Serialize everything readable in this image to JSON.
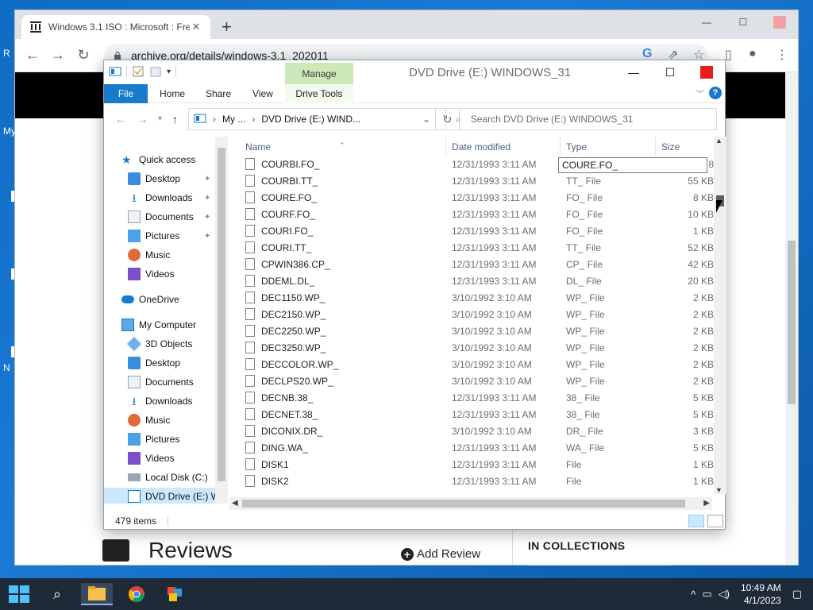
{
  "desktop": {
    "labels": [
      "R",
      "My",
      "N"
    ]
  },
  "browser": {
    "tab_title": "Windows 3.1 ISO : Microsoft : Fre",
    "url": "archive.org/details/windows-3.1_202011",
    "page": {
      "reviews_title": "Reviews",
      "add_review": "Add Review",
      "in_collections": "IN COLLECTIONS"
    }
  },
  "explorer": {
    "window_title": "DVD Drive (E:) WINDOWS_31",
    "contextual_tab_group": "Manage",
    "ribbon_tabs": [
      "File",
      "Home",
      "Share",
      "View",
      "Drive Tools"
    ],
    "breadcrumb": [
      "My ...",
      "DVD Drive (E:) WIND..."
    ],
    "search_placeholder": "Search DVD Drive (E:) WINDOWS_31",
    "nav": {
      "quick_access": "Quick access",
      "quick_items": [
        "Desktop",
        "Downloads",
        "Documents",
        "Pictures",
        "Music",
        "Videos"
      ],
      "onedrive": "OneDrive",
      "my_computer": "My Computer",
      "computer_items": [
        "3D Objects",
        "Desktop",
        "Documents",
        "Downloads",
        "Music",
        "Pictures",
        "Videos",
        "Local Disk (C:)",
        "DVD Drive (E:) W"
      ]
    },
    "columns": [
      "Name",
      "Date modified",
      "Type",
      "Size"
    ],
    "tooltip": "COURE.FO_",
    "files": [
      {
        "name": "COURBI.FO_",
        "date": "12/31/1993 3:11 AM",
        "type": "",
        "size": "8"
      },
      {
        "name": "COURBI.TT_",
        "date": "12/31/1993 3:11 AM",
        "type": "TT_ File",
        "size": "55 KB"
      },
      {
        "name": "COURE.FO_",
        "date": "12/31/1993 3:11 AM",
        "type": "FO_ File",
        "size": "8 KB"
      },
      {
        "name": "COURF.FO_",
        "date": "12/31/1993 3:11 AM",
        "type": "FO_ File",
        "size": "10 KB"
      },
      {
        "name": "COURI.FO_",
        "date": "12/31/1993 3:11 AM",
        "type": "FO_ File",
        "size": "1 KB"
      },
      {
        "name": "COURI.TT_",
        "date": "12/31/1993 3:11 AM",
        "type": "TT_ File",
        "size": "52 KB"
      },
      {
        "name": "CPWIN386.CP_",
        "date": "12/31/1993 3:11 AM",
        "type": "CP_ File",
        "size": "42 KB"
      },
      {
        "name": "DDEML.DL_",
        "date": "12/31/1993 3:11 AM",
        "type": "DL_ File",
        "size": "20 KB"
      },
      {
        "name": "DEC1150.WP_",
        "date": "3/10/1992 3:10 AM",
        "type": "WP_ File",
        "size": "2 KB"
      },
      {
        "name": "DEC2150.WP_",
        "date": "3/10/1992 3:10 AM",
        "type": "WP_ File",
        "size": "2 KB"
      },
      {
        "name": "DEC2250.WP_",
        "date": "3/10/1992 3:10 AM",
        "type": "WP_ File",
        "size": "2 KB"
      },
      {
        "name": "DEC3250.WP_",
        "date": "3/10/1992 3:10 AM",
        "type": "WP_ File",
        "size": "2 KB"
      },
      {
        "name": "DECCOLOR.WP_",
        "date": "3/10/1992 3:10 AM",
        "type": "WP_ File",
        "size": "2 KB"
      },
      {
        "name": "DECLPS20.WP_",
        "date": "3/10/1992 3:10 AM",
        "type": "WP_ File",
        "size": "2 KB"
      },
      {
        "name": "DECNB.38_",
        "date": "12/31/1993 3:11 AM",
        "type": "38_ File",
        "size": "5 KB"
      },
      {
        "name": "DECNET.38_",
        "date": "12/31/1993 3:11 AM",
        "type": "38_ File",
        "size": "5 KB"
      },
      {
        "name": "DICONIX.DR_",
        "date": "3/10/1992 3:10 AM",
        "type": "DR_ File",
        "size": "3 KB"
      },
      {
        "name": "DING.WA_",
        "date": "12/31/1993 3:11 AM",
        "type": "WA_ File",
        "size": "5 KB"
      },
      {
        "name": "DISK1",
        "date": "12/31/1993 3:11 AM",
        "type": "File",
        "size": "1 KB"
      },
      {
        "name": "DISK2",
        "date": "12/31/1993 3:11 AM",
        "type": "File",
        "size": "1 KB"
      }
    ],
    "status": "479 items"
  },
  "taskbar": {
    "time": "10:49 AM",
    "date": "4/1/2023"
  },
  "colors": {
    "file_tab": "#1979ca",
    "manage_tab": "#cde8b9",
    "close_btn": "#ea1b1b",
    "selection": "#cce8ff",
    "taskbar": "#1f2a38"
  }
}
